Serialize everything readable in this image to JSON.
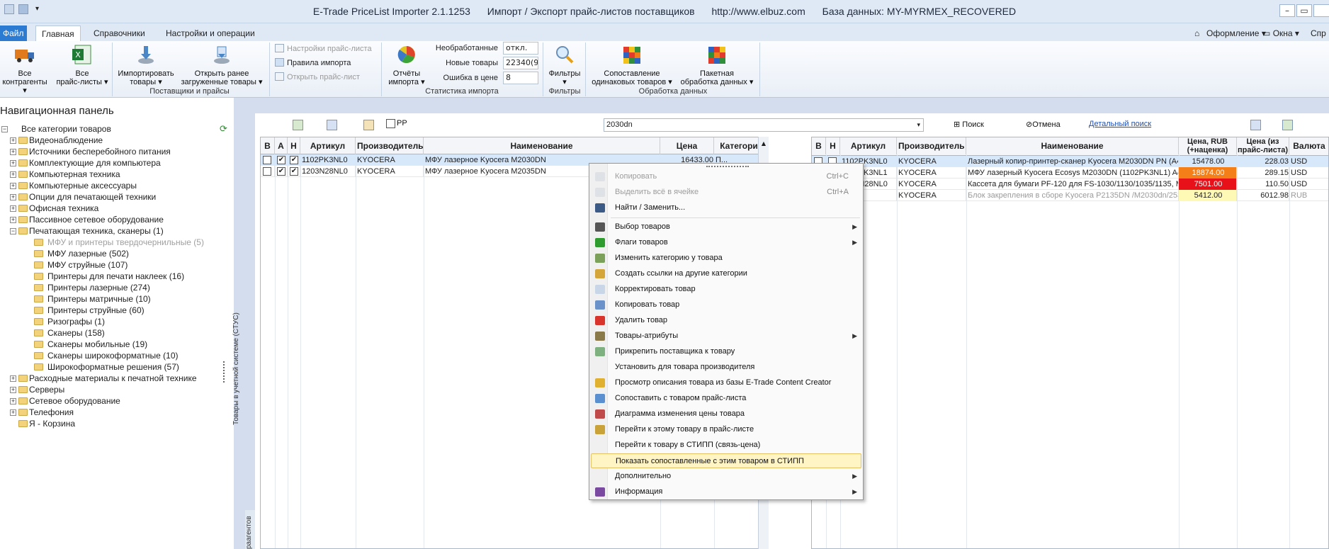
{
  "titlebar": {
    "app": "E-Trade PriceList Importer 2.1.1253",
    "mode": "Импорт / Экспорт прайс-листов поставщиков",
    "url": "http://www.elbuz.com",
    "db": "База данных: MY-MYRMEX_RECOVERED"
  },
  "tabs": {
    "file": "Файл",
    "items": [
      "Главная",
      "Справочники",
      "Настройки и операции"
    ],
    "right": [
      "Оформление",
      "Окна",
      "Спр"
    ]
  },
  "ribbon": {
    "contractors": [
      "Все",
      "контрагенты"
    ],
    "pricelists": [
      "Все",
      "прайс-листы"
    ],
    "import": [
      "Импортировать",
      "товары"
    ],
    "open_loaded": [
      "Открыть ранее",
      "загруженные товары"
    ],
    "group_suppliers": "Поставщики и прайсы",
    "pl_settings": "Настройки прайс-листа",
    "import_rules": "Правила импорта",
    "open_pl": "Открыть прайс-лист",
    "reports": [
      "Отчёты",
      "импорта"
    ],
    "stats": [
      {
        "label": "Необработанные",
        "value": "откл."
      },
      {
        "label": "Новые товары",
        "value": "22340(97"
      },
      {
        "label": "Ошибка в цене",
        "value": "8"
      }
    ],
    "group_stats": "Статистика импорта",
    "filters": "Фильтры",
    "group_filters": "Фильтры",
    "match": [
      "Сопоставление",
      "одинаковых товаров"
    ],
    "batch": [
      "Пакетная",
      "обработка данных"
    ],
    "group_data": "Обработка данных"
  },
  "nav": {
    "title": "Навигационная панель",
    "items": [
      {
        "label": "Все категории товаров",
        "level": 0,
        "exp": "−",
        "dim": false
      },
      {
        "label": "Видеонаблюдение",
        "level": 1,
        "exp": "+",
        "dim": false
      },
      {
        "label": "Источники бесперебойного питания",
        "level": 1,
        "exp": "+",
        "dim": false
      },
      {
        "label": "Комплектующие для компьютера",
        "level": 1,
        "exp": "+",
        "dim": false
      },
      {
        "label": "Компьютерная техника",
        "level": 1,
        "exp": "+",
        "dim": false
      },
      {
        "label": "Компьютерные аксессуары",
        "level": 1,
        "exp": "+",
        "dim": false
      },
      {
        "label": "Опции для печатающей техники",
        "level": 1,
        "exp": "+",
        "dim": false
      },
      {
        "label": "Офисная техника",
        "level": 1,
        "exp": "+",
        "dim": false
      },
      {
        "label": "Пассивное сетевое оборудование",
        "level": 1,
        "exp": "+",
        "dim": false
      },
      {
        "label": "Печатающая техника, сканеры (1)",
        "level": 1,
        "exp": "−",
        "dim": false
      },
      {
        "label": "МФУ и принтеры твердочернильные (5)",
        "level": 2,
        "exp": "",
        "dim": true
      },
      {
        "label": "МФУ лазерные (502)",
        "level": 2,
        "exp": "",
        "dim": false
      },
      {
        "label": "МФУ струйные (107)",
        "level": 2,
        "exp": "",
        "dim": false
      },
      {
        "label": "Принтеры для печати наклеек (16)",
        "level": 2,
        "exp": "",
        "dim": false
      },
      {
        "label": "Принтеры лазерные (274)",
        "level": 2,
        "exp": "",
        "dim": false
      },
      {
        "label": "Принтеры матричные (10)",
        "level": 2,
        "exp": "",
        "dim": false
      },
      {
        "label": "Принтеры струйные (60)",
        "level": 2,
        "exp": "",
        "dim": false
      },
      {
        "label": "Ризографы (1)",
        "level": 2,
        "exp": "",
        "dim": false
      },
      {
        "label": "Сканеры (158)",
        "level": 2,
        "exp": "",
        "dim": false
      },
      {
        "label": "Сканеры мобильные (19)",
        "level": 2,
        "exp": "",
        "dim": false
      },
      {
        "label": "Сканеры широкоформатные (10)",
        "level": 2,
        "exp": "",
        "dim": false
      },
      {
        "label": "Широкоформатные решения (57)",
        "level": 2,
        "exp": "",
        "dim": false
      },
      {
        "label": "Расходные материалы к печатной технике",
        "level": 1,
        "exp": "+",
        "dim": false
      },
      {
        "label": "Серверы",
        "level": 1,
        "exp": "+",
        "dim": false
      },
      {
        "label": "Сетевое оборудование",
        "level": 1,
        "exp": "+",
        "dim": false
      },
      {
        "label": "Телефония",
        "level": 1,
        "exp": "+",
        "dim": false
      },
      {
        "label": "Я - Корзина",
        "level": 1,
        "exp": "",
        "dim": false
      }
    ]
  },
  "status_vertical": "Товары в учетной системе (СТУС)",
  "status_vertical2": "раагентов",
  "toolbar": {
    "pp_label": "PP",
    "search_value": "2030dn",
    "search_btn": "Поиск",
    "cancel_btn": "Отмена",
    "detail_search": "Детальный поиск"
  },
  "left_grid": {
    "headers": [
      "В",
      "А",
      "Н",
      "Артикул",
      "Производитель",
      "Наименование",
      "Цена",
      "Категория"
    ],
    "rows": [
      {
        "v": "",
        "a": "✔",
        "n": "✔",
        "art": "1102PK3NL0",
        "mfr": "KYOCERA",
        "name": "МФУ лазерное Kyocera M2030DN",
        "price": "16433.00",
        "cat": "П..."
      },
      {
        "v": "",
        "a": "✔",
        "n": "✔",
        "art": "1203N28NL0",
        "mfr": "KYOCERA",
        "name": "МФУ лазерное Kyocera M2035DN",
        "price": "",
        "cat": ""
      }
    ]
  },
  "right_grid": {
    "headers": [
      "В",
      "Н",
      "Артикул",
      "Производитель",
      "Наименование",
      "Цена, RUB (+наценка)",
      "Цена (из прайс-листа)",
      "Валюта"
    ],
    "rows": [
      {
        "art": "1102PK3NL0",
        "mfr": "KYOCERA",
        "name": "Лазерный копир-принтер-сканер Kyocera M2030DN PN (A4,",
        "rub": "15478.00",
        "pl": "228.03",
        "cur": "USD",
        "rub_style": "",
        "dim": false
      },
      {
        "art": "1102PK3NL1",
        "mfr": "KYOCERA",
        "name": "МФУ лазерный Kyocera Ecosys M2030DN (1102PK3NL1) A4 D",
        "rub": "18874.00",
        "pl": "289.15",
        "cur": "USD",
        "rub_style": "p-or",
        "dim": false
      },
      {
        "art": "1203N28NL0",
        "mfr": "KYOCERA",
        "name": "Кассета для бумаги PF-120 для FS-1030/1130/1035/1135, M",
        "rub": "7501.00",
        "pl": "110.50",
        "cur": "USD",
        "rub_style": "p-rd",
        "dim": false
      },
      {
        "art": "",
        "mfr": "KYOCERA",
        "name": "Блок закрепления в сборе Kyocera P2135DN /M2030dn/2535",
        "rub": "5412.00",
        "pl": "6012.98",
        "cur": "RUB",
        "rub_style": "p-yl",
        "dim": true
      }
    ]
  },
  "context_menu": {
    "items": [
      {
        "label": "Копировать",
        "shortcut": "Ctrl+C",
        "arrow": false,
        "disabled": true,
        "icon": "copy-icon"
      },
      {
        "label": "Выделить всё в ячейке",
        "shortcut": "Ctrl+A",
        "arrow": false,
        "disabled": true,
        "icon": "select-all-icon"
      },
      {
        "label": "Найти / Заменить...",
        "shortcut": "",
        "arrow": false,
        "disabled": false,
        "icon": "binoculars-icon"
      },
      {
        "sep": true
      },
      {
        "label": "Выбор товаров",
        "shortcut": "",
        "arrow": true,
        "disabled": false,
        "icon": "filter-icon"
      },
      {
        "label": "Флаги товаров",
        "shortcut": "",
        "arrow": true,
        "disabled": false,
        "icon": "checkmark-icon"
      },
      {
        "label": "Изменить категорию у товара",
        "shortcut": "",
        "arrow": false,
        "disabled": false,
        "icon": "category-icon"
      },
      {
        "label": "Создать ссылки на другие категории",
        "shortcut": "",
        "arrow": false,
        "disabled": false,
        "icon": "link-icon"
      },
      {
        "label": "Корректировать товар",
        "shortcut": "",
        "arrow": false,
        "disabled": false,
        "icon": "edit-icon"
      },
      {
        "label": "Копировать товар",
        "shortcut": "",
        "arrow": false,
        "disabled": false,
        "icon": "copy-item-icon"
      },
      {
        "label": "Удалить товар",
        "shortcut": "",
        "arrow": false,
        "disabled": false,
        "icon": "delete-icon"
      },
      {
        "label": "Товары-атрибуты",
        "shortcut": "",
        "arrow": true,
        "disabled": false,
        "icon": "attributes-icon"
      },
      {
        "label": "Прикрепить поставщика к товару",
        "shortcut": "",
        "arrow": false,
        "disabled": false,
        "icon": "supplier-icon"
      },
      {
        "label": "Установить для товара производителя",
        "shortcut": "",
        "arrow": false,
        "disabled": false,
        "icon": ""
      },
      {
        "label": "Просмотр описания товара из базы E-Trade Content Creator",
        "shortcut": "",
        "arrow": false,
        "disabled": false,
        "icon": "description-icon"
      },
      {
        "label": "Сопоставить с товаром прайс-листа",
        "shortcut": "",
        "arrow": false,
        "disabled": false,
        "icon": "match-icon"
      },
      {
        "label": "Диаграмма изменения цены товара",
        "shortcut": "",
        "arrow": false,
        "disabled": false,
        "icon": "chart-icon"
      },
      {
        "label": "Перейти к этому товару в прайс-листе",
        "shortcut": "",
        "arrow": false,
        "disabled": false,
        "icon": "goto-icon"
      },
      {
        "label": "Перейти к товару в СТИПП (связь-цена)",
        "shortcut": "",
        "arrow": false,
        "disabled": false,
        "icon": ""
      },
      {
        "label": "Показать сопоставленные с этим товаром в СТИПП",
        "shortcut": "",
        "arrow": false,
        "disabled": false,
        "icon": "",
        "highlight": true
      },
      {
        "label": "Дополнительно",
        "shortcut": "",
        "arrow": true,
        "disabled": false,
        "icon": ""
      },
      {
        "label": "Информация",
        "shortcut": "",
        "arrow": true,
        "disabled": false,
        "icon": "info-icon"
      }
    ]
  },
  "colors": {
    "file_tab": "#2b7bd3",
    "highlight": "#fff4c4",
    "orange": "#f47e17",
    "red": "#e8111a",
    "yellow": "#fff9b6"
  }
}
